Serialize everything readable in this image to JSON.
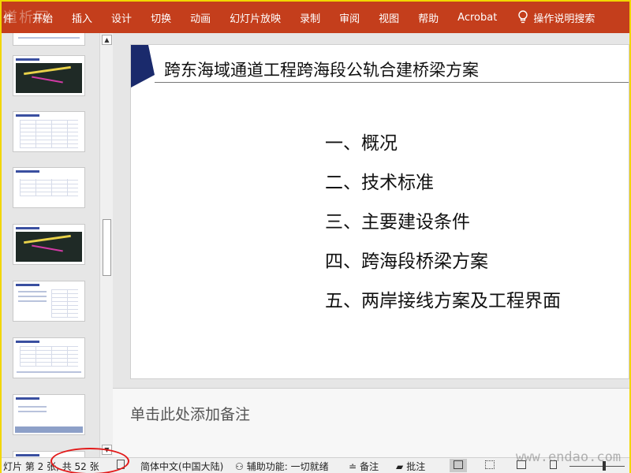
{
  "ribbon": {
    "tabs": [
      "件",
      "开始",
      "插入",
      "设计",
      "切换",
      "动画",
      "幻灯片放映",
      "录制",
      "审阅",
      "视图",
      "帮助",
      "Acrobat"
    ],
    "search_label": "操作说明搜索",
    "watermark": "道析网"
  },
  "slide": {
    "title": "跨东海域通道工程跨海段公轨合建桥梁方案",
    "outline": [
      "一、概况",
      "二、技术标准",
      "三、主要建设条件",
      "四、跨海段桥梁方案",
      "五、两岸接线方案及工程界面"
    ],
    "accent_color": "#1a2a6c"
  },
  "notes": {
    "placeholder": "单击此处添加备注"
  },
  "status": {
    "slide_info": "灯片 第 2 张, 共 52 张",
    "language": "简体中文(中国大陆)",
    "accessibility": "辅助功能: 一切就绪",
    "notes_label": "备注",
    "comments_label": "批注",
    "watermark": "www.endao.com"
  },
  "colors": {
    "ribbon": "#c43e1c",
    "highlight_circle": "#e21a1a"
  }
}
